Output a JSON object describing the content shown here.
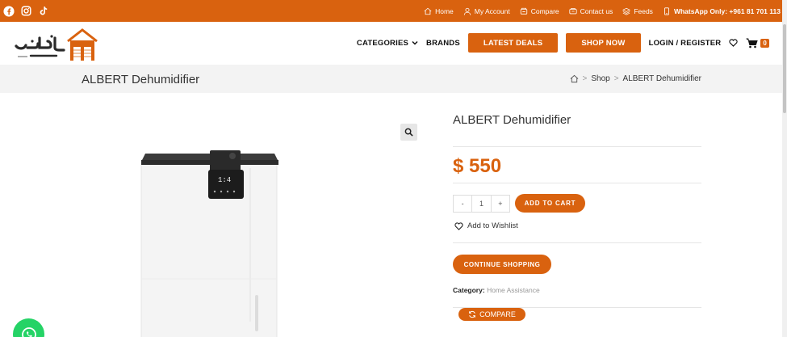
{
  "topbar": {
    "social": [
      "facebook-icon",
      "instagram-icon",
      "tiktok-icon"
    ],
    "links": [
      {
        "label": "Home",
        "icon": "home-icon"
      },
      {
        "label": "My Account",
        "icon": "user-icon"
      },
      {
        "label": "Compare",
        "icon": "compare-icon"
      },
      {
        "label": "Contact us",
        "icon": "phone-icon"
      },
      {
        "label": "Feeds",
        "icon": "feeds-icon"
      }
    ],
    "whatsapp": "WhatsApp Only: +961 81 701 113"
  },
  "header": {
    "logo_text": "عدنان طقوش",
    "nav": {
      "categories": "CATEGORIES",
      "brands": "BRANDS",
      "latest_deals": "LATEST DEALS",
      "shop_now": "SHOP NOW",
      "login": "LOGIN / REGISTER",
      "cart_count": "0"
    }
  },
  "titlebar": {
    "title": "ALBERT Dehumidifier",
    "breadcrumb": {
      "shop": "Shop",
      "current": "ALBERT Dehumidifier"
    }
  },
  "product": {
    "title": "ALBERT Dehumidifier",
    "price": "$ 550",
    "quantity": "1",
    "qty_minus": "-",
    "qty_plus": "+",
    "add_to_cart": "ADD TO CART",
    "wishlist": "Add to Wishlist",
    "continue": "CONTINUE SHOPPING",
    "category_label": "Category:",
    "category_value": "Home Assistance",
    "compare": "COMPARE"
  },
  "colors": {
    "accent": "#d9620f",
    "whatsapp": "#25d366"
  }
}
